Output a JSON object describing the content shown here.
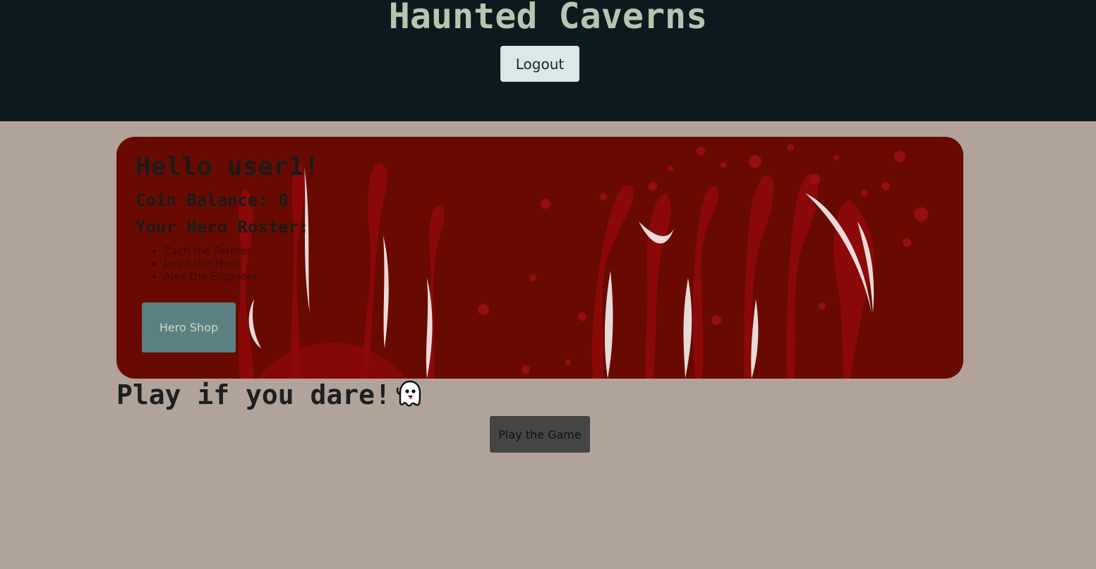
{
  "header": {
    "title": "Haunted Caverns",
    "logout_label": "Logout"
  },
  "dashboard": {
    "greeting": "Hello user1!",
    "coin_balance": "Coin Balance: 0",
    "roster_title": "Your Hero Roster:",
    "heroes": [
      "Zach the Farmer",
      "Jared the Hero",
      "Alex the Engineer"
    ],
    "shop_label": "Hero Shop"
  },
  "main": {
    "tagline": "Play if you dare!",
    "tagline_icon": "ghost-icon",
    "play_label": "Play the Game"
  },
  "colors": {
    "header_bg": "#0c1a1f",
    "page_bg": "#b2a39a",
    "card_bg": "#690a00",
    "title": "#b5c6b0"
  }
}
